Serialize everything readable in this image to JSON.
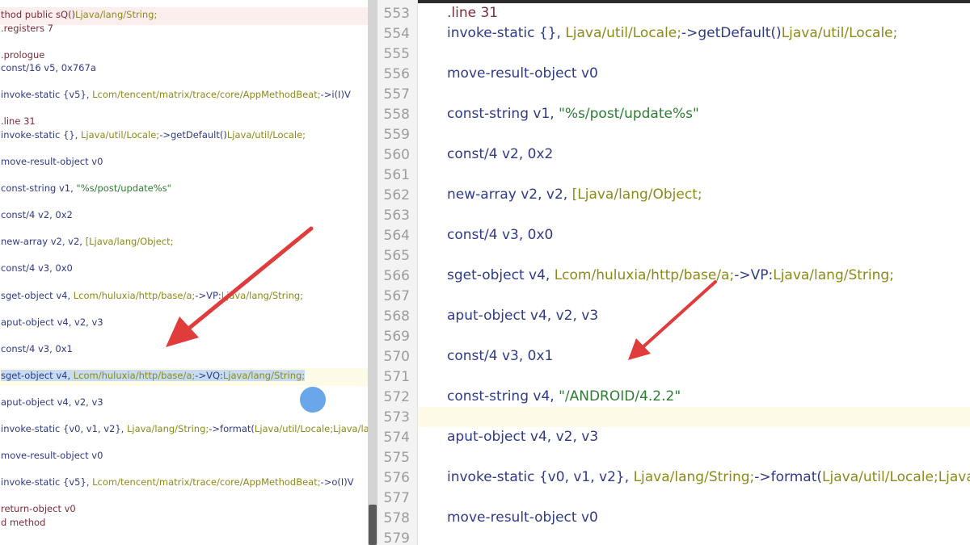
{
  "left_pane": {
    "lines": [
      {
        "segments": [
          [
            "dir",
            "thod public sQ()"
          ],
          [
            "type",
            "Ljava/lang/String;"
          ]
        ],
        "hl": "red"
      },
      {
        "segments": [
          [
            "dir",
            ".registers 7"
          ]
        ]
      },
      {
        "segments": []
      },
      {
        "segments": [
          [
            "dir",
            ".prologue"
          ]
        ]
      },
      {
        "segments": [
          [
            "kw",
            "const/16 v5, 0x767a"
          ]
        ]
      },
      {
        "segments": []
      },
      {
        "segments": [
          [
            "kw",
            "invoke-static {v5}, "
          ],
          [
            "type",
            "Lcom/tencent/matrix/trace/core/AppMethodBeat;"
          ],
          [
            "kw",
            "->i(I)V"
          ]
        ]
      },
      {
        "segments": []
      },
      {
        "segments": [
          [
            "dir",
            ".line 31"
          ]
        ]
      },
      {
        "segments": [
          [
            "kw",
            "invoke-static {}, "
          ],
          [
            "type",
            "Ljava/util/Locale;"
          ],
          [
            "kw",
            "->getDefault()"
          ],
          [
            "type",
            "Ljava/util/Locale;"
          ]
        ]
      },
      {
        "segments": []
      },
      {
        "segments": [
          [
            "kw",
            "move-result-object v0"
          ]
        ]
      },
      {
        "segments": []
      },
      {
        "segments": [
          [
            "kw",
            "const-string v1, "
          ],
          [
            "str",
            "\"%s/post/update%s\""
          ]
        ]
      },
      {
        "segments": []
      },
      {
        "segments": [
          [
            "kw",
            "const/4 v2, 0x2"
          ]
        ]
      },
      {
        "segments": []
      },
      {
        "segments": [
          [
            "kw",
            "new-array v2, v2, "
          ],
          [
            "type",
            "[Ljava/lang/Object;"
          ]
        ]
      },
      {
        "segments": []
      },
      {
        "segments": [
          [
            "kw",
            "const/4 v3, 0x0"
          ]
        ]
      },
      {
        "segments": []
      },
      {
        "segments": [
          [
            "kw",
            "sget-object v4, "
          ],
          [
            "type",
            "Lcom/huluxia/http/base/a;"
          ],
          [
            "kw",
            "->VP:"
          ],
          [
            "type",
            "Ljava/lang/String;"
          ]
        ]
      },
      {
        "segments": []
      },
      {
        "segments": [
          [
            "kw",
            "aput-object v4, v2, v3"
          ]
        ]
      },
      {
        "segments": []
      },
      {
        "segments": [
          [
            "kw",
            "const/4 v3, 0x1"
          ]
        ]
      },
      {
        "segments": []
      },
      {
        "segments": [
          [
            "kw",
            "sget-object v4, "
          ],
          [
            "type",
            "Lcom/huluxia/http/base/a;"
          ],
          [
            "kw",
            "->VQ:"
          ],
          [
            "type",
            "Ljava/lang/String;"
          ]
        ],
        "hl": "yellow",
        "selected": true
      },
      {
        "segments": []
      },
      {
        "segments": [
          [
            "kw",
            "aput-object v4, v2, v3"
          ]
        ]
      },
      {
        "segments": []
      },
      {
        "segments": [
          [
            "kw",
            "invoke-static {v0, v1, v2}, "
          ],
          [
            "type",
            "Ljava/lang/String;"
          ],
          [
            "kw",
            "->format("
          ],
          [
            "type",
            "Ljava/util/Locale;Ljava/lang/S"
          ]
        ]
      },
      {
        "segments": []
      },
      {
        "segments": [
          [
            "kw",
            "move-result-object v0"
          ]
        ]
      },
      {
        "segments": []
      },
      {
        "segments": [
          [
            "kw",
            "invoke-static {v5}, "
          ],
          [
            "type",
            "Lcom/tencent/matrix/trace/core/AppMethodBeat;"
          ],
          [
            "kw",
            "->o(I)V"
          ]
        ]
      },
      {
        "segments": []
      },
      {
        "segments": [
          [
            "dir",
            "return-object v0"
          ]
        ]
      },
      {
        "segments": [
          [
            "dir",
            "d method"
          ]
        ]
      }
    ]
  },
  "right_pane": {
    "lines": [
      {
        "num": "553",
        "segments": [
          [
            "dir",
            ".line 31"
          ]
        ]
      },
      {
        "num": "554",
        "segments": [
          [
            "kw",
            "invoke-static {}, "
          ],
          [
            "type",
            "Ljava/util/Locale;"
          ],
          [
            "kw",
            "->getDefault()"
          ],
          [
            "type",
            "Ljava/util/Locale;"
          ]
        ]
      },
      {
        "num": "555",
        "segments": []
      },
      {
        "num": "556",
        "segments": [
          [
            "kw",
            "move-result-object v0"
          ]
        ]
      },
      {
        "num": "557",
        "segments": []
      },
      {
        "num": "558",
        "segments": [
          [
            "kw",
            "const-string v1, "
          ],
          [
            "str",
            "\"%s/post/update%s\""
          ]
        ]
      },
      {
        "num": "559",
        "segments": []
      },
      {
        "num": "560",
        "segments": [
          [
            "kw",
            "const/4 v2, 0x2"
          ]
        ]
      },
      {
        "num": "561",
        "segments": []
      },
      {
        "num": "562",
        "segments": [
          [
            "kw",
            "new-array v2, v2, "
          ],
          [
            "type",
            "[Ljava/lang/Object;"
          ]
        ]
      },
      {
        "num": "563",
        "segments": []
      },
      {
        "num": "564",
        "segments": [
          [
            "kw",
            "const/4 v3, 0x0"
          ]
        ]
      },
      {
        "num": "565",
        "segments": []
      },
      {
        "num": "566",
        "segments": [
          [
            "kw",
            "sget-object v4, "
          ],
          [
            "type",
            "Lcom/huluxia/http/base/a;"
          ],
          [
            "kw",
            "->VP:"
          ],
          [
            "type",
            "Ljava/lang/String;"
          ]
        ]
      },
      {
        "num": "567",
        "segments": []
      },
      {
        "num": "568",
        "segments": [
          [
            "kw",
            "aput-object v4, v2, v3"
          ]
        ]
      },
      {
        "num": "569",
        "segments": []
      },
      {
        "num": "570",
        "segments": [
          [
            "kw",
            "const/4 v3, 0x1"
          ]
        ]
      },
      {
        "num": "571",
        "segments": []
      },
      {
        "num": "572",
        "segments": [
          [
            "kw",
            "const-string v4, "
          ],
          [
            "str",
            "\"/ANDROID/4.2.2\""
          ]
        ]
      },
      {
        "num": "573",
        "segments": [],
        "hl": true
      },
      {
        "num": "574",
        "segments": [
          [
            "kw",
            "aput-object v4, v2, v3"
          ]
        ]
      },
      {
        "num": "575",
        "segments": []
      },
      {
        "num": "576",
        "segments": [
          [
            "kw",
            "invoke-static {v0, v1, v2}, "
          ],
          [
            "type",
            "Ljava/lang/String;"
          ],
          [
            "kw",
            "->format("
          ],
          [
            "type",
            "Ljava/util/Locale;Ljava"
          ]
        ]
      },
      {
        "num": "577",
        "segments": []
      },
      {
        "num": "578",
        "segments": [
          [
            "kw",
            "move-result-object v0"
          ]
        ]
      },
      {
        "num": "579",
        "segments": []
      }
    ]
  },
  "colors": {
    "arrow": "#e03c3c",
    "selection": "#c7dcf1",
    "highlight_line": "#fdfbe8",
    "keyword": "#2f3a88",
    "type": "#8c8a18",
    "string": "#2e7d32",
    "directive": "#7a2e3a"
  }
}
